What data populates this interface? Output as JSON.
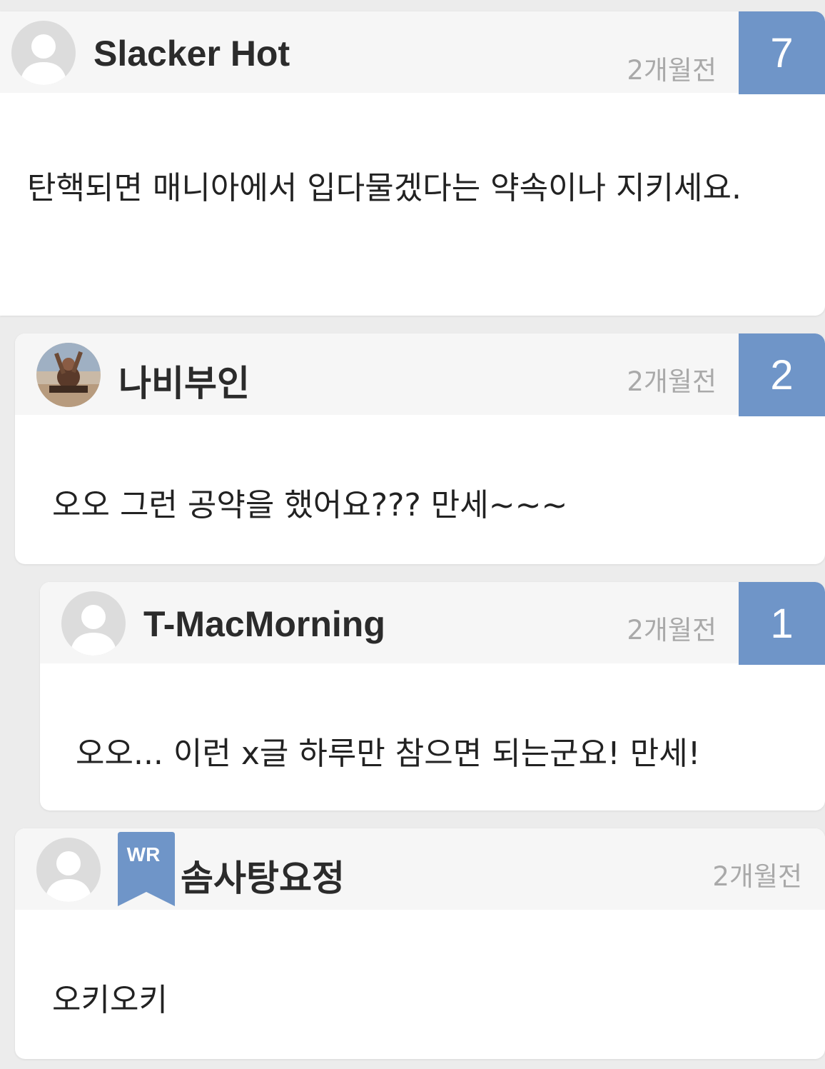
{
  "comments": [
    {
      "author": "Slacker Hot",
      "time": "2개월전",
      "votes": "7",
      "text": "탄핵되면  매니아에서  입다물겠다는  약속이나  지키세요."
    },
    {
      "author": "나비부인",
      "time": "2개월전",
      "votes": "2",
      "text": "오오 그런 공약을 했어요??? 만세~~~"
    },
    {
      "author": "T-MacMorning",
      "time": "2개월전",
      "votes": "1",
      "text": "오오... 이런 x글 하루만 참으면 되는군요! 만세!"
    },
    {
      "author": "솜사탕요정",
      "time": "2개월전",
      "badge": "WR",
      "text": "오키오키"
    }
  ],
  "colors": {
    "vote_bg": "#6f95c8",
    "badge_bg": "#6f95c8",
    "header_bg": "#f6f6f6",
    "page_bg": "#ececec"
  },
  "icons": {
    "default_avatar": "user-silhouette-icon",
    "photo_avatar": "profile-photo",
    "writer_badge": "bookmark-ribbon-icon"
  }
}
